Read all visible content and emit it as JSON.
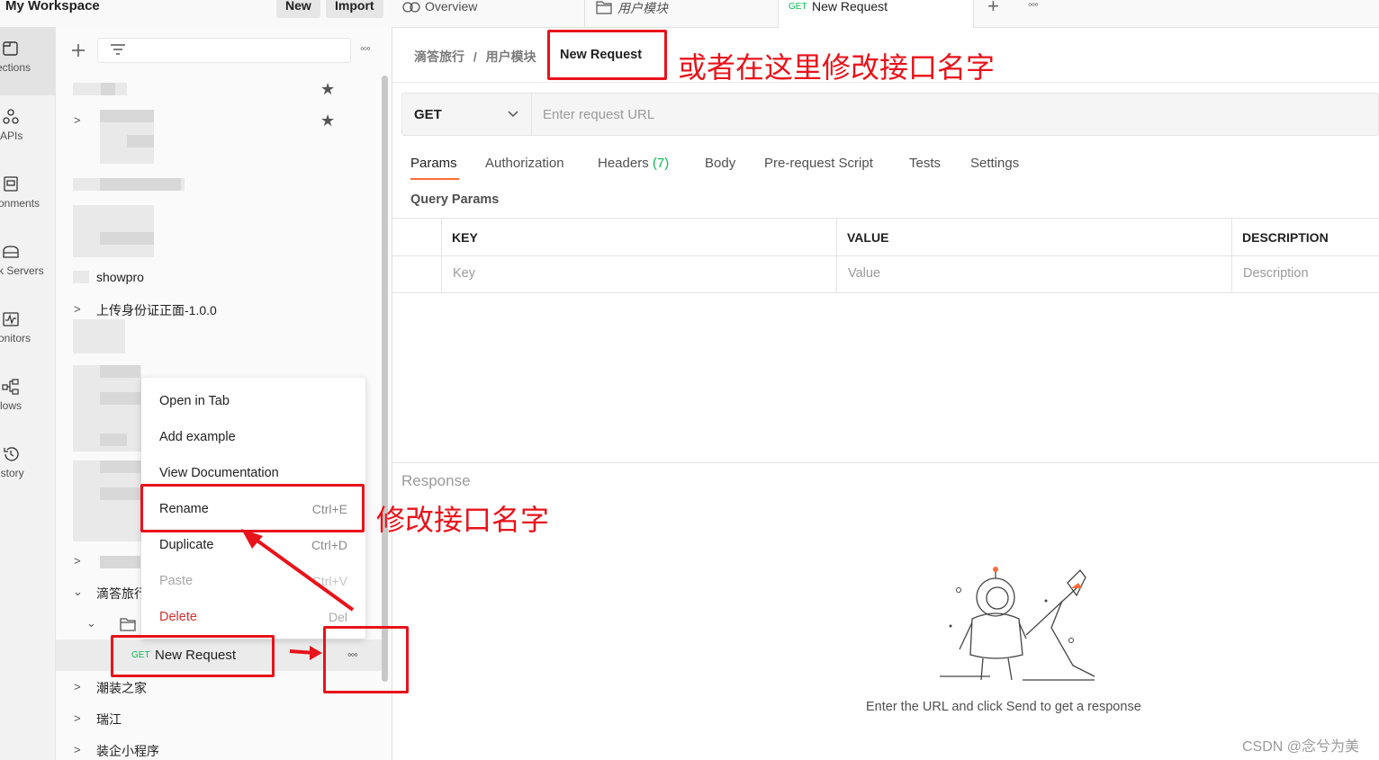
{
  "workspace": {
    "title": "My Workspace",
    "new_label": "New",
    "import_label": "Import"
  },
  "rail": [
    {
      "icon": "collections-icon",
      "label": "ections"
    },
    {
      "icon": "apis-icon",
      "label": "APIs"
    },
    {
      "icon": "environments-icon",
      "label": "onments"
    },
    {
      "icon": "mock-servers-icon",
      "label": "k Servers"
    },
    {
      "icon": "monitors-icon",
      "label": "onitors"
    },
    {
      "icon": "flows-icon",
      "label": "lows"
    },
    {
      "icon": "history-icon",
      "label": "istory"
    }
  ],
  "sidebar": {
    "more_label": "◦◦◦",
    "items": {
      "showpro": "showpro",
      "id_upload": "上传身份证正面-1.0.0",
      "didadi": "滴答旅行",
      "new_request_method": "GET",
      "new_request_name": "New Request",
      "chaozhuang": "潮装之家",
      "ruijiang": "瑞江",
      "zhuangqi": "装企小程序"
    }
  },
  "context_menu": {
    "open_in_tab": "Open in Tab",
    "add_example": "Add example",
    "view_documentation": "View Documentation",
    "rename": "Rename",
    "rename_shortcut": "Ctrl+E",
    "duplicate": "Duplicate",
    "duplicate_shortcut": "Ctrl+D",
    "paste": "Paste",
    "paste_shortcut": "Ctrl+V",
    "delete": "Delete",
    "delete_shortcut": "Del"
  },
  "tabs": {
    "overview": "Overview",
    "folder": "用户模块",
    "request_method": "GET",
    "request_name": "New Request",
    "add": "+",
    "more": "◦◦◦"
  },
  "breadcrumb": {
    "collection": "滴答旅行",
    "sep": "/",
    "folder": "用户模块",
    "request": "New Request"
  },
  "request": {
    "method": "GET",
    "url_placeholder": "Enter request URL",
    "tabs": {
      "params": "Params",
      "authorization": "Authorization",
      "headers": "Headers",
      "headers_count": "(7)",
      "body": "Body",
      "pre_request": "Pre-request Script",
      "tests": "Tests",
      "settings": "Settings"
    },
    "query_params": {
      "title": "Query Params",
      "key_header": "KEY",
      "value_header": "VALUE",
      "description_header": "DESCRIPTION",
      "key_placeholder": "Key",
      "value_placeholder": "Value",
      "description_placeholder": "Description"
    }
  },
  "response": {
    "label": "Response",
    "empty_text": "Enter the URL and click Send to get a response"
  },
  "annotations": {
    "top": "或者在这里修改接口名字",
    "middle": "修改接口名字"
  },
  "watermark": "CSDN @念兮为美",
  "colors": {
    "accent": "#ff6c37",
    "annotation_red": "#e8131b",
    "get_green": "#0cbb52",
    "delete_red": "#d32f2f"
  }
}
